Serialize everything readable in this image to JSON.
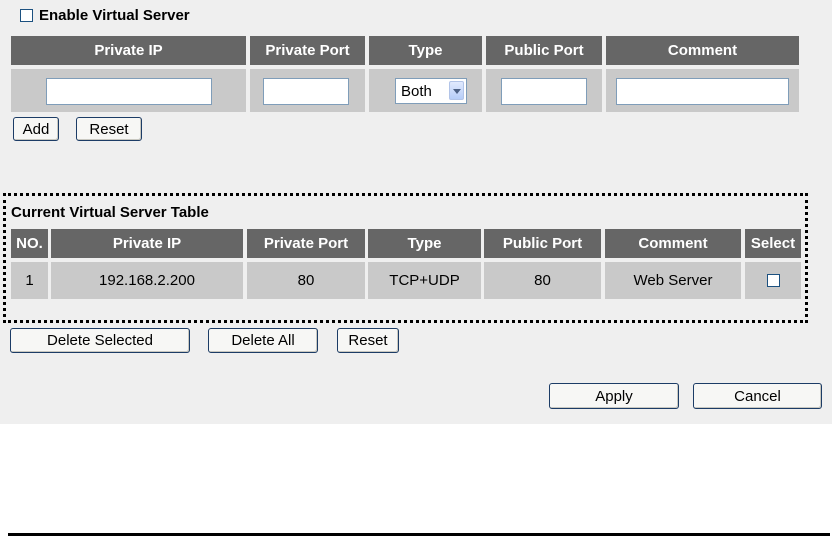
{
  "enable": {
    "label": "Enable Virtual Server",
    "checked": false
  },
  "form": {
    "headers": [
      "Private IP",
      "Private Port",
      "Type",
      "Public Port",
      "Comment"
    ],
    "private_ip": "",
    "private_port": "",
    "type": "Both",
    "public_port": "",
    "comment": "",
    "add_label": "Add",
    "reset_label": "Reset"
  },
  "current_table": {
    "title": "Current Virtual Server Table",
    "headers": [
      "NO.",
      "Private IP",
      "Private Port",
      "Type",
      "Public Port",
      "Comment",
      "Select"
    ],
    "rows": [
      {
        "no": "1",
        "private_ip": "192.168.2.200",
        "private_port": "80",
        "type": "TCP+UDP",
        "public_port": "80",
        "comment": "Web Server",
        "selected": false
      }
    ]
  },
  "actions": {
    "delete_selected": "Delete Selected",
    "delete_all": "Delete All",
    "reset": "Reset",
    "apply": "Apply",
    "cancel": "Cancel"
  }
}
